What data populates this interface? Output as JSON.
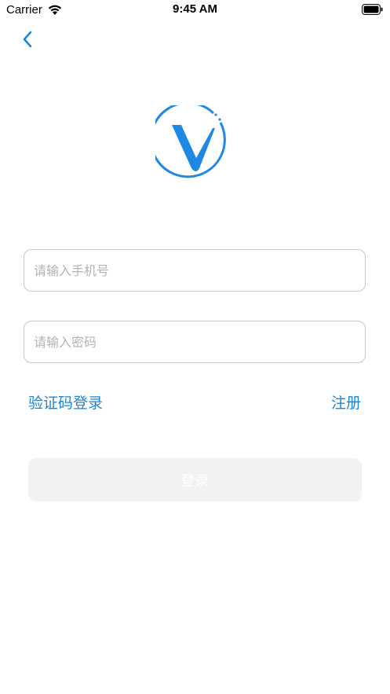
{
  "status_bar": {
    "carrier": "Carrier",
    "time": "9:45 AM",
    "wifi_icon": "wifi-icon",
    "battery_icon": "battery-icon"
  },
  "nav": {
    "back_icon": "chevron-left-icon"
  },
  "logo": {
    "icon": "v-logo-icon",
    "color": "#1e88e5"
  },
  "form": {
    "phone_placeholder": "请输入手机号",
    "phone_value": "",
    "password_placeholder": "请输入密码",
    "password_value": ""
  },
  "links": {
    "code_login": "验证码登录",
    "register": "注册"
  },
  "login_button": {
    "label": "登录",
    "enabled": false
  },
  "colors": {
    "accent": "#1a86d9",
    "button_disabled_bg": "#f2f2f2",
    "border": "#c8c8c8"
  }
}
